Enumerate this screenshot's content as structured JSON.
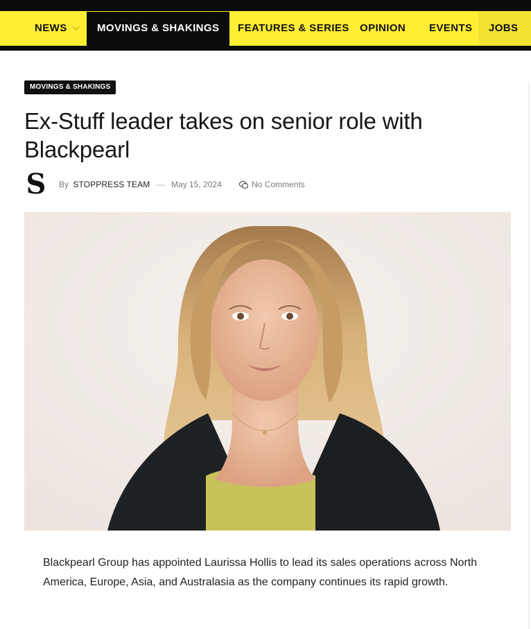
{
  "nav": {
    "items": [
      {
        "label": "NEWS",
        "has_dropdown": true
      },
      {
        "label": "MOVINGS & SHAKINGS",
        "active": true
      },
      {
        "label": "FEATURES & SERIES"
      },
      {
        "label": "OPINION"
      },
      {
        "label": "EVENTS"
      },
      {
        "label": "JOBS"
      }
    ]
  },
  "colors": {
    "brand_yellow": "#ffee33",
    "dark": "#0b0b0b"
  },
  "article": {
    "category": "MOVINGS & SHAKINGS",
    "title": "Ex-Stuff leader takes on senior role with Blackpearl",
    "author_logo": "S",
    "by_label": "By",
    "author": "STOPPRESS TEAM",
    "date": "May 15, 2024",
    "comments_icon": "comments-icon",
    "comments": "No Comments",
    "lead": "Blackpearl Group has appointed Laurissa Hollis to lead its sales operations across North America, Europe, Asia, and Australasia as the company continues its rapid growth."
  }
}
